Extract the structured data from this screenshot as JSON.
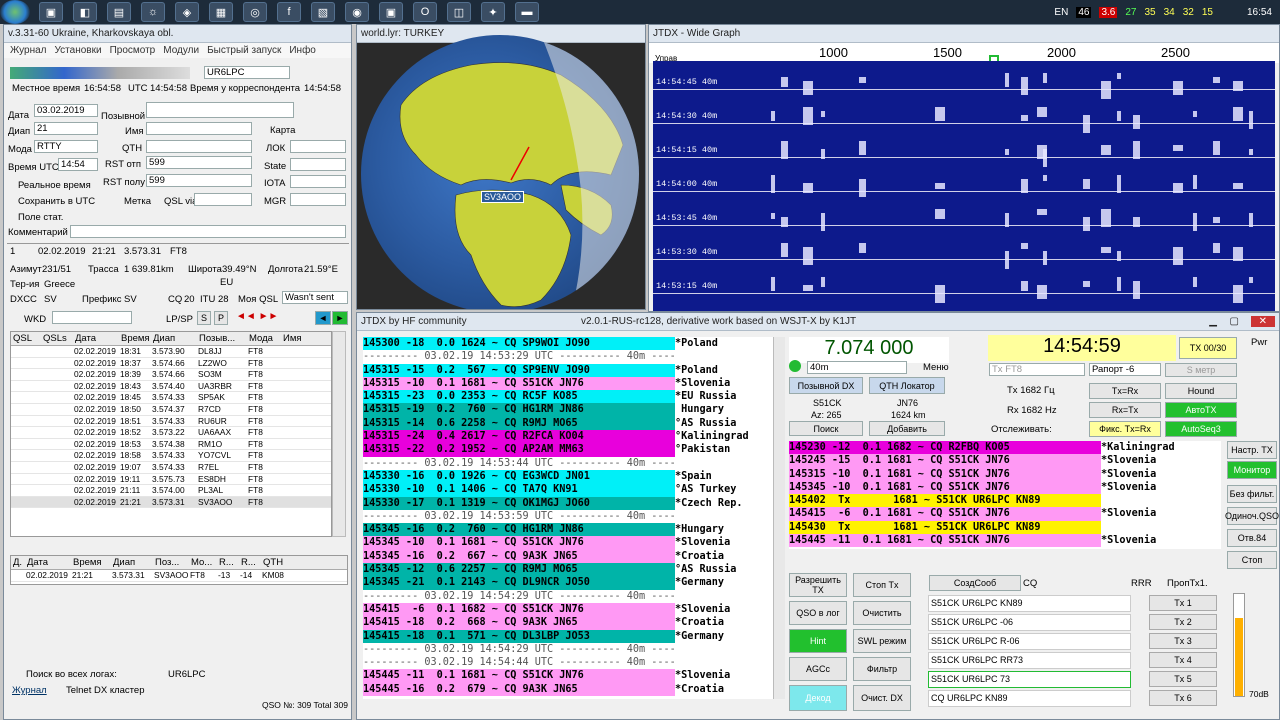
{
  "taskbar": {
    "lang": "EN",
    "nums": [
      "46",
      "3.6",
      "27",
      "35",
      "34",
      "32",
      "15"
    ],
    "clock": "16:54"
  },
  "logger": {
    "title": "v.3.31-60 Ukraine, Kharkovskaya obl.",
    "menu": [
      "Журнал",
      "Установки",
      "Просмотр",
      "Модули",
      "Быстрый запуск",
      "Инфо"
    ],
    "call": "UR6LPC",
    "local_time_label": "Местное время",
    "local_time": "16:54:58",
    "utc_label": "UTC",
    "utc": "14:54:58",
    "corr_label": "Время у корреспондента",
    "corr_time": "14:54:58",
    "date_label": "Дата",
    "date": "03.02.2019",
    "band_label": "Диап",
    "band": "21",
    "mode_label": "Мода",
    "mode": "RTTY",
    "time_label": "Время UTC",
    "time": "14:54",
    "realtime": "Реальное время",
    "save_utc": "Сохранить в UTC",
    "field_label": "Поле стат.",
    "comment_label": "Комментарий",
    "callsign_label": "Позывной",
    "name_label": "Имя",
    "qth_label": "QTH",
    "rst_s_label": "RST отп",
    "rst_s": "599",
    "rst_r_label": "RST полу",
    "rst_r": "599",
    "qsl_label": "QSL via",
    "map_label": "Карта",
    "loc_label": "ЛОК",
    "state_label": "State",
    "iota_label": "IOTA",
    "mgr_label": "MGR",
    "label_label": "Метка",
    "last": {
      "n": "1",
      "date": "02.02.2019",
      "time": "21:21",
      "freq": "3.573.31",
      "mode": "FT8"
    },
    "azimuth_label": "Азимут",
    "azimuth": "231/51",
    "track_label": "Трасса",
    "track": "1 639.81km",
    "lat_label": "Широта",
    "lat": "39.49°N",
    "lon_label": "Долгота",
    "lon": "21.59°E",
    "terr_label": "Тер-ия",
    "terr": "Greece",
    "cont": "EU",
    "dxcc_label": "DXCC",
    "dxcc": "SV",
    "prefix_label": "Префикс",
    "prefix": "SV",
    "cq_label": "CQ",
    "cq": "20",
    "itu_label": "ITU",
    "itu": "28",
    "myqsl_label": "Моя QSL",
    "myqsl": "Wasn't sent",
    "wkd": "WKD",
    "lpsp": "LP/SP",
    "log_headers": [
      "QSL",
      "QSLs",
      "Дата",
      "Время",
      "Диап",
      "Позыв...",
      "Мода",
      "Имя"
    ],
    "log_rows": [
      [
        "",
        "",
        "02.02.2019",
        "18:31",
        "3.573.90",
        "DL8JJ",
        "FT8"
      ],
      [
        "",
        "",
        "02.02.2019",
        "18:37",
        "3.574.66",
        "LZ2WO",
        "FT8"
      ],
      [
        "",
        "",
        "02.02.2019",
        "18:39",
        "3.574.66",
        "SO3M",
        "FT8"
      ],
      [
        "",
        "",
        "02.02.2019",
        "18:43",
        "3.574.40",
        "UA3RBR",
        "FT8"
      ],
      [
        "",
        "",
        "02.02.2019",
        "18:45",
        "3.574.33",
        "SP5AK",
        "FT8"
      ],
      [
        "",
        "",
        "02.02.2019",
        "18:50",
        "3.574.37",
        "R7CD",
        "FT8"
      ],
      [
        "",
        "",
        "02.02.2019",
        "18:51",
        "3.574.33",
        "RU6UR",
        "FT8"
      ],
      [
        "",
        "",
        "02.02.2019",
        "18:52",
        "3.573.22",
        "UA6AAX",
        "FT8"
      ],
      [
        "",
        "",
        "02.02.2019",
        "18:53",
        "3.574.38",
        "RM1O",
        "FT8"
      ],
      [
        "",
        "",
        "02.02.2019",
        "18:58",
        "3.574.33",
        "YO7CVL",
        "FT8"
      ],
      [
        "",
        "",
        "02.02.2019",
        "19:07",
        "3.574.33",
        "R7EL",
        "FT8"
      ],
      [
        "",
        "",
        "02.02.2019",
        "19:11",
        "3.575.73",
        "ES8DH",
        "FT8"
      ],
      [
        "",
        "",
        "02.02.2019",
        "21:11",
        "3.574.00",
        "PL3AL",
        "FT8"
      ],
      [
        "",
        "",
        "02.02.2019",
        "21:21",
        "3.573.31",
        "SV3AOO",
        "FT8"
      ]
    ],
    "prev_headers": [
      "Д.",
      "Дата",
      "Время",
      "Диап",
      "Поз...",
      "Мо...",
      "R...",
      "R...",
      "QTH"
    ],
    "prev_row": [
      "02.02.2019",
      "21:21",
      "3.573.31",
      "SV3AOO",
      "FT8",
      "-13",
      "-14",
      "KM08"
    ],
    "search_all": "Поиск во всех логах:",
    "search_call": "UR6LPC",
    "tabs": [
      "Журнал",
      "Telnet DX кластер"
    ],
    "status": "QSO №: 309 Total 309"
  },
  "globe": {
    "title": "world.lyr: TURKEY",
    "target": "SV3AOO"
  },
  "wide": {
    "title": "JTDX - Wide Graph",
    "ctrl": "Управ",
    "scale": [
      "1000",
      "1500",
      "2000",
      "2500"
    ],
    "times": [
      "14:54:45",
      "14:54:30",
      "14:54:15",
      "14:54:00",
      "14:53:45",
      "14:53:30",
      "14:53:15",
      "14:53:00"
    ],
    "band": "40m"
  },
  "jtdx": {
    "title": "JTDX by HF community",
    "version": "v2.0.1-RUS-rc128, derivative work based on WSJT-X by K1JT",
    "freq": "7.074 000",
    "time": "14:54:59",
    "txcount": "TX 00/30",
    "pwr": "Pwr",
    "band": "40m",
    "menu_label": "Меню",
    "dx_call_btn": "Позывной DX",
    "dx_loc_btn": "QTH Локатор",
    "dx_call": "S51CK",
    "dx_loc": "JN76",
    "az": "Az: 265",
    "dist": "1624 km",
    "search_btn": "Поиск",
    "add_btn": "Добавить",
    "mode_sel": "Tx FT8",
    "report_label": "Рапорт -6",
    "s_meter": "S метр",
    "tx_hz": "Tx  1682  Гц",
    "rx_hz": "Rx  1682  Hz",
    "txrx": "Tx=Rx",
    "rxtx": "Rx=Tx",
    "hound": "Hound",
    "autotx": "АвтоTX",
    "autoseq": "AutoSeq3",
    "track_label": "Отслеживать:",
    "fix": "Фикс. Tx=Rx",
    "right_btns": [
      "Настр. TX",
      "Монитор",
      "Без фильт.",
      "Одиноч.QSO",
      "Отв.84",
      "Стоп"
    ],
    "ctrl_btns": [
      "Разрешить TX",
      "Стоп Tx",
      "QSO в лог",
      "Очистить",
      "Hint",
      "SWL режим",
      "AGCc",
      "Фильтр",
      "Декод",
      "Очист. DX"
    ],
    "gen_btn": "СоздСооб",
    "gen_cq": "CQ",
    "rrr": "RRR",
    "skip": "ПропТх1.",
    "msgs": [
      "S51CK UR6LPC KN89",
      "S51CK UR6LPC -06",
      "S51CK UR6LPC R-06",
      "S51CK UR6LPC RR73",
      "S51CK UR6LPC 73",
      "CQ UR6LPC KN89"
    ],
    "txbtns": [
      "Tx 1",
      "Tx 2",
      "Tx 3",
      "Tx 4",
      "Tx 5",
      "Tx 6"
    ],
    "scale": [
      "80",
      "70",
      "60",
      "50",
      "40",
      "30",
      "20",
      "10",
      "0"
    ],
    "db": "70dB",
    "colors": {
      "cyan": "#00f0f8",
      "teal": "#00b4a8",
      "pink": "#ff99f4",
      "magenta": "#e800dc",
      "yellow": "#fff200",
      "white": "#ffffff"
    },
    "band_lines": [
      {
        "t": "145300 -18  0.0 1624 ~ CQ SP9WOI JO90",
        "c": "*Poland",
        "bg": "cyan"
      },
      {
        "t": "--------- 03.02.19 14:53:29 UTC ---------- 40m --------",
        "c": "",
        "bg": "white",
        "sep": true
      },
      {
        "t": "145315 -15  0.2  567 ~ CQ SP9ENV JO90",
        "c": "*Poland",
        "bg": "cyan"
      },
      {
        "t": "145315 -10  0.1 1681 ~ CQ S51CK JN76",
        "c": "*Slovenia",
        "bg": "pink"
      },
      {
        "t": "145315 -23  0.0 2353 ~ CQ RC5F KO85",
        "c": "*EU Russia",
        "bg": "cyan"
      },
      {
        "t": "145315 -19  0.2  760 ~ CQ HG1RM JN86",
        "c": " Hungary",
        "bg": "teal"
      },
      {
        "t": "145315 -14  0.6 2258 ~ CQ R9MJ MO65",
        "c": "°AS Russia",
        "bg": "teal"
      },
      {
        "t": "145315 -24  0.4 2617 ~ CQ R2FCA KO04",
        "c": "°Kaliningrad",
        "bg": "magenta"
      },
      {
        "t": "145315 -22  0.2 1952 ~ CQ AP2AM MM63",
        "c": "°Pakistan",
        "bg": "magenta"
      },
      {
        "t": "--------- 03.02.19 14:53:44 UTC ---------- 40m --------",
        "c": "",
        "bg": "white",
        "sep": true
      },
      {
        "t": "145330 -16  0.0 1926 ~ CQ EG3WCD JN01",
        "c": "*Spain",
        "bg": "cyan"
      },
      {
        "t": "145330 -10  0.1 1406 ~ CQ TA7Q KN91",
        "c": "°AS Turkey",
        "bg": "cyan"
      },
      {
        "t": "145330 -17  0.1 1319 ~ CQ OK1MGJ JO60",
        "c": "*Czech Rep.",
        "bg": "teal"
      },
      {
        "t": "--------- 03.02.19 14:53:59 UTC ---------- 40m --------",
        "c": "",
        "bg": "white",
        "sep": true
      },
      {
        "t": "145345 -16  0.2  760 ~ CQ HG1RM JN86",
        "c": "*Hungary",
        "bg": "teal"
      },
      {
        "t": "145345 -10  0.1 1681 ~ CQ S51CK JN76",
        "c": "*Slovenia",
        "bg": "pink"
      },
      {
        "t": "145345 -16  0.2  667 ~ CQ 9A3K JN65",
        "c": "*Croatia",
        "bg": "pink"
      },
      {
        "t": "145345 -12  0.6 2257 ~ CQ R9MJ MO65",
        "c": "°AS Russia",
        "bg": "teal"
      },
      {
        "t": "145345 -21  0.1 2143 ~ CQ DL9NCR JO50",
        "c": "*Germany",
        "bg": "teal"
      },
      {
        "t": "--------- 03.02.19 14:54:29 UTC ---------- 40m --------",
        "c": "",
        "bg": "white",
        "sep": true
      },
      {
        "t": "145415  -6  0.1 1682 ~ CQ S51CK JN76",
        "c": "*Slovenia",
        "bg": "pink"
      },
      {
        "t": "145415 -18  0.2  668 ~ CQ 9A3K JN65",
        "c": "*Croatia",
        "bg": "pink"
      },
      {
        "t": "145415 -18  0.1  571 ~ CQ DL3LBP JO53",
        "c": "*Germany",
        "bg": "teal"
      },
      {
        "t": "--------- 03.02.19 14:54:29 UTC ---------- 40m --------",
        "c": "",
        "bg": "white",
        "sep": true
      },
      {
        "t": "--------- 03.02.19 14:54:44 UTC ---------- 40m --------",
        "c": "",
        "bg": "white",
        "sep": true
      },
      {
        "t": "145445 -11  0.1 1681 ~ CQ S51CK JN76",
        "c": "*Slovenia",
        "bg": "pink"
      },
      {
        "t": "145445 -16  0.2  679 ~ CQ 9A3K JN65",
        "c": "*Croatia",
        "bg": "pink"
      }
    ],
    "rx_lines": [
      {
        "t": "145230 -12  0.1 1682 ~ CQ R2FBQ KO05",
        "c": "*Kaliningrad",
        "bg": "magenta"
      },
      {
        "t": "145245 -15  0.1 1681 ~ CQ S51CK JN76",
        "c": "*Slovenia",
        "bg": "pink"
      },
      {
        "t": "145315 -10  0.1 1681 ~ CQ S51CK JN76",
        "c": "*Slovenia",
        "bg": "pink"
      },
      {
        "t": "145345 -10  0.1 1681 ~ CQ S51CK JN76",
        "c": "*Slovenia",
        "bg": "pink"
      },
      {
        "t": "145402  Tx       1681 ~ S51CK UR6LPC KN89",
        "c": "",
        "bg": "yellow"
      },
      {
        "t": "145415  -6  0.1 1681 ~ CQ S51CK JN76",
        "c": "*Slovenia",
        "bg": "pink"
      },
      {
        "t": "145430  Tx       1681 ~ S51CK UR6LPC KN89",
        "c": "",
        "bg": "yellow"
      },
      {
        "t": "145445 -11  0.1 1681 ~ CQ S51CK JN76",
        "c": "*Slovenia",
        "bg": "pink"
      }
    ]
  }
}
